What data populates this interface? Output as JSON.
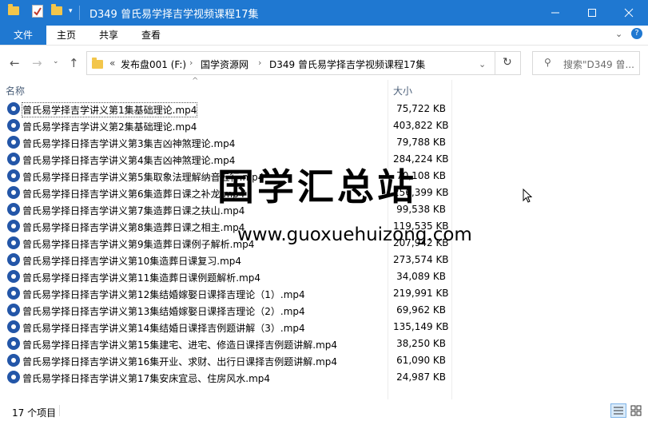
{
  "window": {
    "title": "D349 曾氏易学择吉学视频课程17集",
    "controls": [
      "minimize",
      "maximize",
      "close"
    ]
  },
  "ribbon": {
    "tabs": [
      "文件",
      "主页",
      "共享",
      "查看"
    ]
  },
  "address": {
    "breadcrumbs": [
      "«",
      "发布盘001 (F:)",
      "国学资源网",
      "D349 曾氏易学择吉学视频课程17集"
    ],
    "search_placeholder": "搜索\"D349 曾..."
  },
  "columns": {
    "name": "名称",
    "size": "大小"
  },
  "files": [
    {
      "name": "曾氏易学择吉学讲义第1集基础理论.mp4",
      "size": "75,722 KB"
    },
    {
      "name": "曾氏易学择吉学讲义第2集基础理论.mp4",
      "size": "403,822 KB"
    },
    {
      "name": "曾氏易学择日择吉学讲义第3集吉凶神煞理论.mp4",
      "size": "79,788 KB"
    },
    {
      "name": "曾氏易学择日择吉学讲义第4集吉凶神煞理论.mp4",
      "size": "284,224 KB"
    },
    {
      "name": "曾氏易学择日择吉学讲义第5集取象法理解纳音五行.mp4",
      "size": "70,108 KB"
    },
    {
      "name": "曾氏易学择日择吉学讲义第6集造葬日课之补龙.mp4",
      "size": "256,399 KB"
    },
    {
      "name": "曾氏易学择日择吉学讲义第7集造葬日课之扶山.mp4",
      "size": "99,538 KB"
    },
    {
      "name": "曾氏易学择日择吉学讲义第8集造葬日课之相主.mp4",
      "size": "119,535 KB"
    },
    {
      "name": "曾氏易学择日择吉学讲义第9集造葬日课例子解析.mp4",
      "size": "207,942 KB"
    },
    {
      "name": "曾氏易学择日择吉学讲义第10集造葬日课复习.mp4",
      "size": "273,574 KB"
    },
    {
      "name": "曾氏易学择日择吉学讲义第11集造葬日课例题解析.mp4",
      "size": "34,089 KB"
    },
    {
      "name": "曾氏易学择日择吉学讲义第12集结婚嫁娶日课择吉理论（1）.mp4",
      "size": "219,991 KB"
    },
    {
      "name": "曾氏易学择日择吉学讲义第13集结婚嫁娶日课择吉理论（2）.mp4",
      "size": "69,962 KB"
    },
    {
      "name": "曾氏易学择日择吉学讲义第14集结婚日课择吉例题讲解（3）.mp4",
      "size": "135,149 KB"
    },
    {
      "name": "曾氏易学择日择吉学讲义第15集建宅、进宅、修造日课择吉例题讲解.mp4",
      "size": "38,250 KB"
    },
    {
      "name": "曾氏易学择日择吉学讲义第16集开业、求财、出行日课择吉例题讲解.mp4",
      "size": "61,090 KB"
    },
    {
      "name": "曾氏易学择日择吉学讲义第17集安床宜忌、住房风水.mp4",
      "size": "24,987 KB"
    }
  ],
  "status": {
    "count": "17 个项目"
  },
  "watermark": {
    "title": "国学汇总站",
    "url": "www.guoxuehuizong.com"
  },
  "colors": {
    "accent": "#1f78d1",
    "header_text": "#4c607a",
    "file_icon": "#2356a8"
  }
}
